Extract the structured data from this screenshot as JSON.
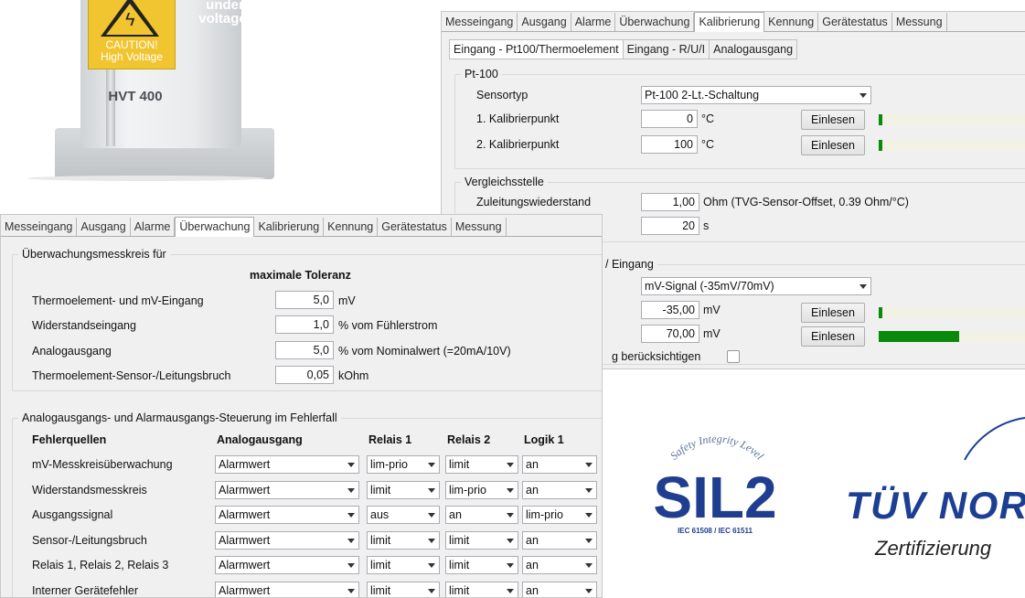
{
  "device": {
    "caution_text": "CAUTION!\nHigh Voltage",
    "voltage_text": "under\nvoltage!",
    "model": "HVT 400"
  },
  "calib_window": {
    "tabs": [
      "Messeingang",
      "Ausgang",
      "Alarme",
      "Überwachung",
      "Kalibrierung",
      "Kennung",
      "Gerätestatus",
      "Messung"
    ],
    "active_tab": "Kalibrierung",
    "subtabs": [
      "Eingang - Pt100/Thermoelement",
      "Eingang - R/U/I",
      "Analogausgang"
    ],
    "pt100": {
      "title": "Pt-100",
      "sensortyp_label": "Sensortyp",
      "sensortyp_value": "Pt-100 2-Lt.-Schaltung",
      "kp1_label": "1. Kalibrierpunkt",
      "kp1_value": "0",
      "kp1_unit": "°C",
      "kp1_progress": 0.02,
      "kp2_label": "2. Kalibrierpunkt",
      "kp2_value": "100",
      "kp2_unit": "°C",
      "kp2_progress": 0.02,
      "einlesen": "Einlesen"
    },
    "vergleich": {
      "title": "Vergleichsstelle",
      "zuleitung_label": "Zuleitungswiederstand",
      "zuleitung_value": "1,00",
      "zuleitung_unit": "Ohm (TVG-Sensor-Offset, 0.39 Ohm/°C)",
      "time_value": "20",
      "time_unit": "s"
    },
    "mv": {
      "title_fragment": "/ Eingang",
      "signal_value": "mV-Signal (-35mV/70mV)",
      "p1_value": "-35,00",
      "p1_unit": "mV",
      "p1_progress": 0.02,
      "p2_value": "70,00",
      "p2_unit": "mV",
      "p2_progress": 0.49,
      "einlesen": "Einlesen",
      "checkbox_label_fragment": "g berücksichtigen"
    }
  },
  "monitor_window": {
    "tabs": [
      "Messeingang",
      "Ausgang",
      "Alarme",
      "Überwachung",
      "Kalibrierung",
      "Kennung",
      "Gerätestatus",
      "Messung"
    ],
    "active_tab": "Überwachung",
    "group1": {
      "title": "Überwachungsmesskreis für",
      "header": "maximale Toleranz",
      "rows": [
        {
          "label": "Thermoelement- und mV-Eingang",
          "value": "5,0",
          "unit": "mV"
        },
        {
          "label": "Widerstandseingang",
          "value": "1,0",
          "unit": "% vom Fühlerstrom"
        },
        {
          "label": "Analogausgang",
          "value": "5,0",
          "unit": "% vom Nominalwert (=20mA/10V)"
        },
        {
          "label": "Thermoelement-Sensor-/Leitungsbruch",
          "value": "0,05",
          "unit": "kOhm"
        }
      ]
    },
    "group2": {
      "title": "Analogausgangs- und Alarmausgangs-Steuerung im Fehlerfall",
      "headers": [
        "Fehlerquellen",
        "Analogausgang",
        "Relais 1",
        "Relais 2",
        "Logik 1"
      ],
      "rows": [
        {
          "source": "mV-Messkreisüberwachung",
          "analog": "Alarmwert",
          "r1": "lim-prio",
          "r2": "limit",
          "l1": "an"
        },
        {
          "source": "Widerstandsmesskreis",
          "analog": "Alarmwert",
          "r1": "limit",
          "r2": "lim-prio",
          "l1": "an"
        },
        {
          "source": "Ausgangssignal",
          "analog": "Alarmwert",
          "r1": "aus",
          "r2": "an",
          "l1": "lim-prio"
        },
        {
          "source": "Sensor-/Leitungsbruch",
          "analog": "Alarmwert",
          "r1": "limit",
          "r2": "limit",
          "l1": "an"
        },
        {
          "source": "Relais 1, Relais 2, Relais 3",
          "analog": "Alarmwert",
          "r1": "limit",
          "r2": "limit",
          "l1": "an"
        },
        {
          "source": "Interner Gerätefehler",
          "analog": "Alarmwert",
          "r1": "limit",
          "r2": "limit",
          "l1": "an"
        }
      ]
    }
  },
  "sil_logo": {
    "arc_text": "Safety Integrity Level",
    "main_text": "SIL2",
    "sub_text": "IEC 61508 / IEC 61511",
    "color": "#1f3e8f"
  },
  "tuv_logo": {
    "main_text": "TÜV NORD",
    "sub_text": "Zertifizierung",
    "color": "#1c3f94"
  }
}
